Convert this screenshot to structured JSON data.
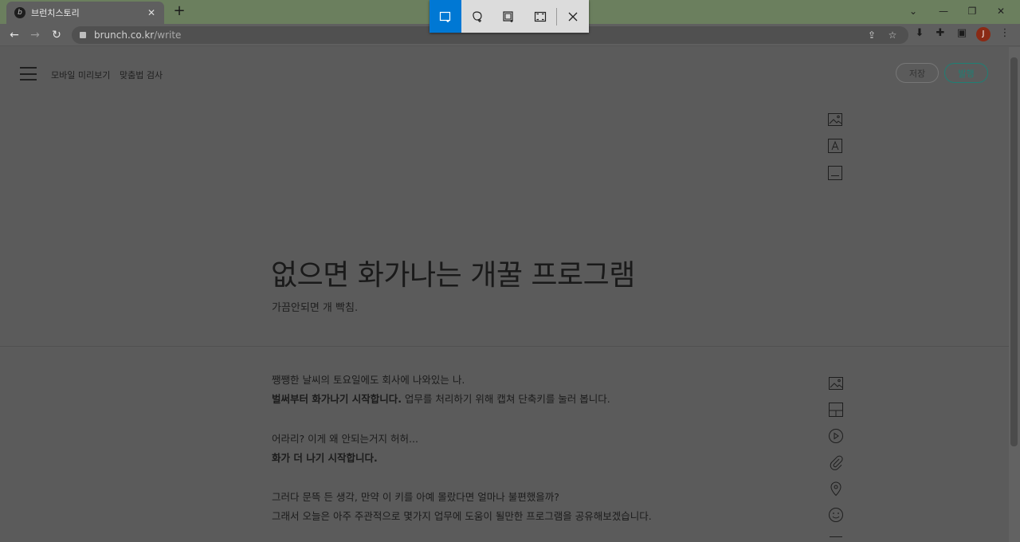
{
  "browser": {
    "tab_title": "브런치스토리",
    "tab_close": "✕",
    "new_tab": "+",
    "url_host": "brunch.co.kr",
    "url_path": "/write",
    "avatar_letter": "J"
  },
  "snipping_toolbar": {
    "tools": [
      "rectangle-snip-icon",
      "freeform-snip-icon",
      "window-snip-icon",
      "fullscreen-snip-icon",
      "close-icon"
    ],
    "active_color": "#0078d4"
  },
  "editor_header": {
    "mobile_preview": "모바일 미리보기",
    "spell_check": "맞춤법 검사",
    "save_label": "저장",
    "publish_label": "발행",
    "publish_color": "#1f7f74"
  },
  "cover": {
    "title": "없으면 화가나는 개꿀 프로그램",
    "subtitle": "가끔안되면 개 빡침."
  },
  "body": {
    "p1_line1": "쨍쨍한 날씨의 토요일에도 회사에 나와있는 나.",
    "p1_line2_bold": "벌써부터 화가나기 시작합니다.",
    "p1_line2_rest": " 업무를 처리하기 위해 캡쳐 단축키를 눌러 봅니다.",
    "p2_line1": "어라리? 이게 왜 안되는거지 허허...",
    "p2_line2_bold": "화가 더 나기 시작합니다.",
    "p3_line1": "그러다 문뜩 든 생각, 만약 이 키를 아예 몰랐다면 얼마나 불편했을까?",
    "p3_line2": "그래서 오늘은 아주 주관적으로 몇가지 업무에 도움이 될만한 프로그램을 공유해보겠습니다."
  }
}
